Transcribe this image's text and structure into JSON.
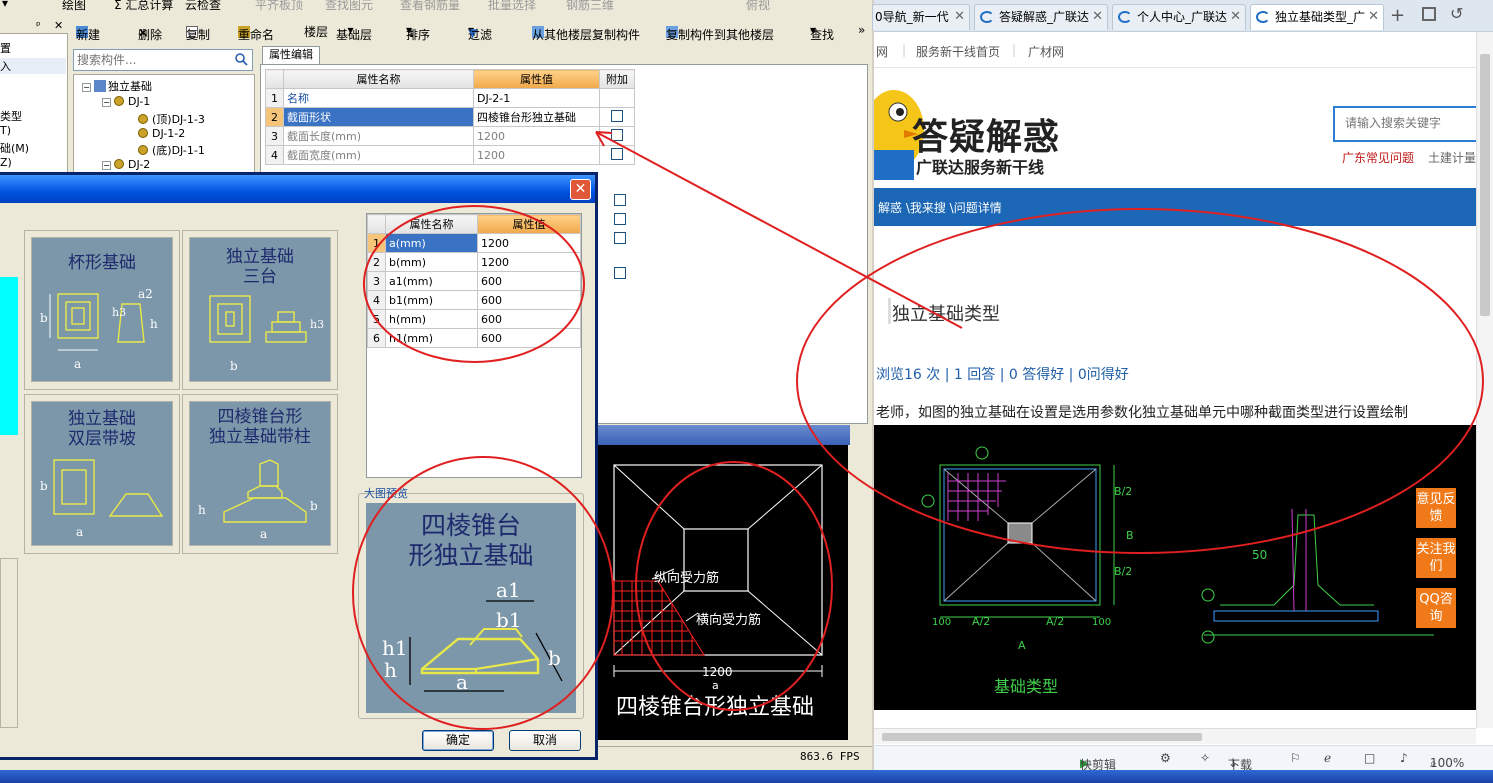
{
  "menubar": {
    "items": [
      "绘图",
      "Σ 汇总计算",
      "云检查",
      "平齐板顶",
      "查找图元",
      "查看钢筋量",
      "批量选择",
      "钢筋三维",
      "俯视"
    ]
  },
  "toolbar": {
    "new": "新建",
    "delete": "删除",
    "copy": "复制",
    "rename": "重命名",
    "floor_label": "楼层",
    "floor_value": "基础层",
    "sort": "排序",
    "filter": "过滤",
    "copy_from": "从其他楼层复制构件",
    "copy_to": "复制构件到其他楼层",
    "find": "查找"
  },
  "left_panel": {
    "items": [
      "置",
      "入",
      "类型",
      "T)",
      "础(M)",
      "Z)"
    ]
  },
  "search": {
    "placeholder": "搜索构件..."
  },
  "tree": {
    "root": "独立基础",
    "nodes": [
      "DJ-1",
      "(顶)DJ-1-3",
      "DJ-1-2",
      "(底)DJ-1-1",
      "DJ-2"
    ]
  },
  "property_editor": {
    "tab": "属性编辑",
    "headers": [
      "属性名称",
      "属性值",
      "附加"
    ],
    "rows": [
      {
        "n": "1",
        "name": "名称",
        "value": "DJ-2-1"
      },
      {
        "n": "2",
        "name": "截面形状",
        "value": "四棱锥台形独立基础"
      },
      {
        "n": "3",
        "name": "截面长度(mm)",
        "value": "1200"
      },
      {
        "n": "4",
        "name": "截面宽度(mm)",
        "value": "1200"
      }
    ]
  },
  "dialog": {
    "thumbnails": [
      {
        "title_l1": "杯形基础",
        "title_l2": ""
      },
      {
        "title_l1": "独立基础",
        "title_l2": "三台"
      },
      {
        "title_l1": "独立基础",
        "title_l2": "双层带坡"
      },
      {
        "title_l1": "四棱锥台形",
        "title_l2": "独立基础带柱"
      }
    ],
    "param_headers": [
      "属性名称",
      "属性值"
    ],
    "params": [
      {
        "n": "1",
        "name": "a(mm)",
        "value": "1200"
      },
      {
        "n": "2",
        "name": "b(mm)",
        "value": "1200"
      },
      {
        "n": "3",
        "name": "a1(mm)",
        "value": "600"
      },
      {
        "n": "4",
        "name": "b1(mm)",
        "value": "600"
      },
      {
        "n": "5",
        "name": "h(mm)",
        "value": "600"
      },
      {
        "n": "6",
        "name": "h1(mm)",
        "value": "600"
      }
    ],
    "preview_label": "大图预览",
    "preview_title_l1": "四棱锥台",
    "preview_title_l2": "形独立基础",
    "ok": "确定",
    "cancel": "取消"
  },
  "cad": {
    "label_long": "纵向受力筋",
    "label_trans": "横向受力筋",
    "dimension": "1200",
    "dim_a": "a",
    "caption": "四棱锥台形独立基础"
  },
  "status": {
    "fps": "863.6 FPS"
  },
  "browser": {
    "tabs": [
      {
        "label": "0导航_新一代",
        "active": false
      },
      {
        "label": "答疑解惑_广联达",
        "active": false
      },
      {
        "label": "个人中心_广联达",
        "active": false
      },
      {
        "label": "独立基础类型_广",
        "active": true
      }
    ],
    "nav_links": [
      "网",
      "服务新干线首页",
      "广材网"
    ],
    "site_title": "答疑解惑",
    "site_subtitle": "广联达服务新干线",
    "search_placeholder": "请输入搜索关键字",
    "hot_links": [
      "广东常见问题",
      "土建计量"
    ],
    "breadcrumb": "解惑 \\我来搜 \\问题详情",
    "question_title": "独立基础类型",
    "question_meta": "浏览16 次 | 1 回答 | 0 答得好 | 0问得好",
    "question_body": "老师，如图的独立基础在设置是选用参数化独立基础单元中哪种截面类型进行设置绘制",
    "image_caption": "基础类型",
    "side_buttons": [
      "意见反馈",
      "关注我们",
      "QQ咨询"
    ],
    "status_items": [
      "快剪辑",
      "下载",
      "100%"
    ]
  },
  "colors": {
    "annotation": "#e02020",
    "accent_blue": "#1c67b5",
    "orange": "#f07a1a",
    "header_orange": "#f0a84a"
  }
}
